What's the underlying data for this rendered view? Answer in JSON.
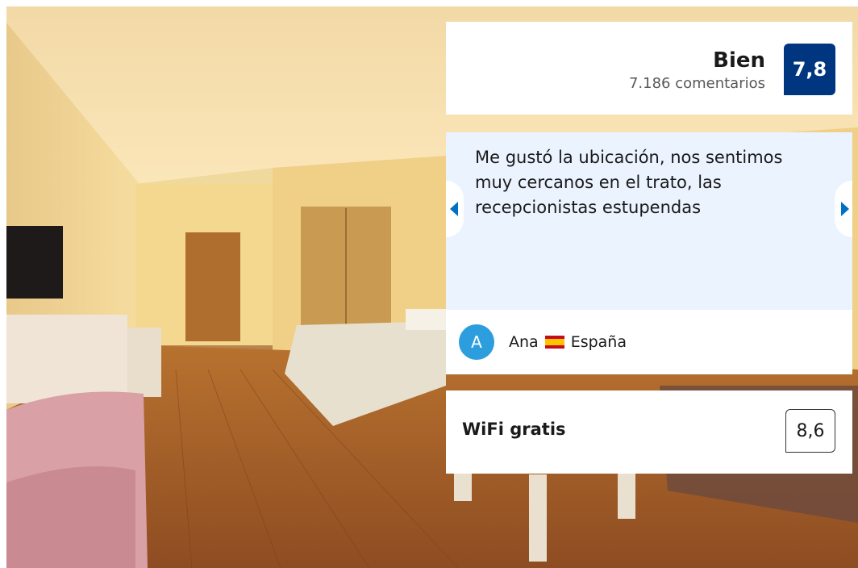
{
  "rating": {
    "label": "Bien",
    "reviews_count": "7.186 comentarios",
    "score": "7,8",
    "badge_color": "#003580"
  },
  "review": {
    "text": "Me gustó la ubicación, nos sentimos muy cercanos en el trato, las recepcionistas estupendas",
    "prev_icon": "chevron-left-icon",
    "next_icon": "chevron-right-icon",
    "reviewer": {
      "initial": "A",
      "name": "Ana",
      "country_flag": "spain-flag-icon",
      "country": "España"
    }
  },
  "facility": {
    "label": "WiFi gratis",
    "score": "8,6"
  },
  "accent_color": "#0071c2"
}
